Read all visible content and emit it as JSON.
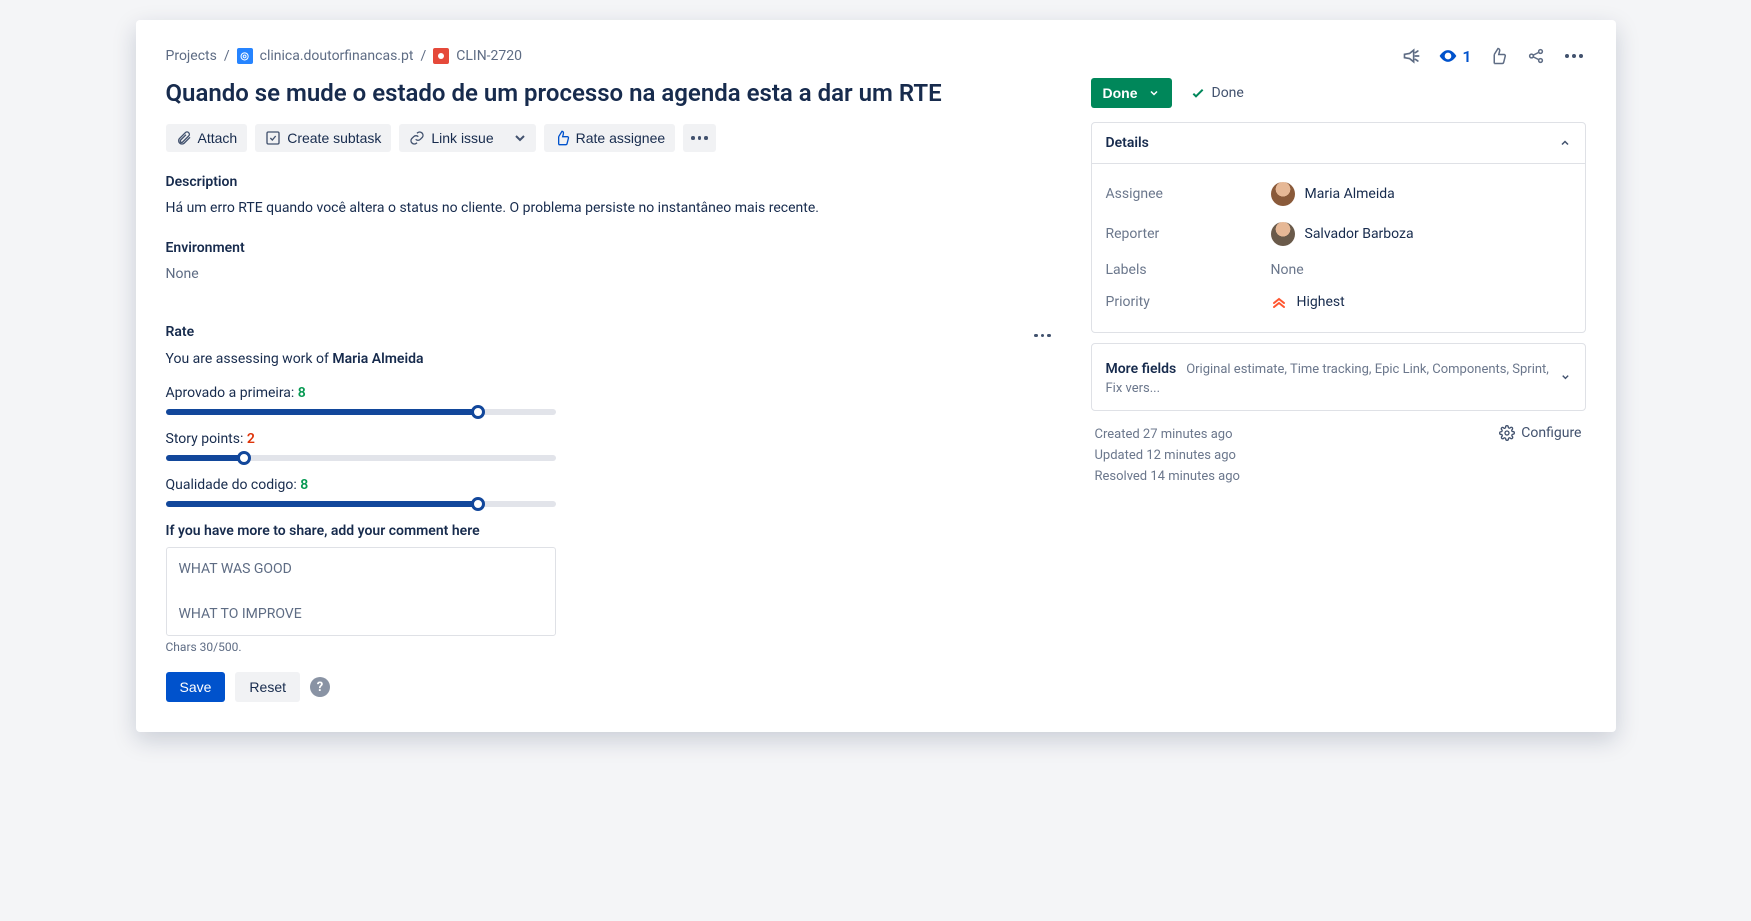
{
  "breadcrumb": {
    "root": "Projects",
    "project": "clinica.doutorfinancas.pt",
    "issue_key": "CLIN-2720"
  },
  "header_actions": {
    "watch_count": "1"
  },
  "title": "Quando se mude o estado de um processo na agenda esta a dar um RTE",
  "toolbar": {
    "attach": "Attach",
    "create_subtask": "Create subtask",
    "link_issue": "Link issue",
    "rate_assignee": "Rate assignee"
  },
  "description": {
    "label": "Description",
    "text": "Há um erro RTE quando você altera o status no cliente. O problema persiste no instantâneo mais recente."
  },
  "environment": {
    "label": "Environment",
    "value": "None"
  },
  "rate": {
    "label": "Rate",
    "assess_prefix": "You are assessing work of ",
    "assess_name": "Maria Almeida",
    "sliders": [
      {
        "label": "Aprovado a primeira:",
        "value": "8",
        "color": "green",
        "pct": 80
      },
      {
        "label": "Story points:",
        "value": "2",
        "color": "red",
        "pct": 20
      },
      {
        "label": "Qualidade do codigo:",
        "value": "8",
        "color": "green",
        "pct": 80
      }
    ],
    "comment_label": "If you have more to share, add your comment here",
    "comment_line1": "WHAT WAS GOOD",
    "comment_line2": "WHAT TO IMPROVE",
    "chars": "Chars 30/500.",
    "save": "Save",
    "reset": "Reset"
  },
  "status": {
    "button": "Done",
    "workflow": "Done"
  },
  "details": {
    "panel_title": "Details",
    "assignee_label": "Assignee",
    "assignee_value": "Maria Almeida",
    "reporter_label": "Reporter",
    "reporter_value": "Salvador Barboza",
    "labels_label": "Labels",
    "labels_value": "None",
    "priority_label": "Priority",
    "priority_value": "Highest"
  },
  "more_fields": {
    "label": "More fields",
    "sub": "Original estimate, Time tracking, Epic Link, Components, Sprint, Fix vers..."
  },
  "meta": {
    "created": "Created 27 minutes ago",
    "updated": "Updated 12 minutes ago",
    "resolved": "Resolved 14 minutes ago",
    "configure": "Configure"
  }
}
